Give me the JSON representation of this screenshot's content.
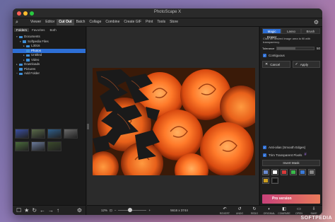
{
  "window": {
    "title": "PhotoScape X"
  },
  "menu": {
    "items": [
      "Viewer",
      "Editor",
      "Cut Out",
      "Batch",
      "Collage",
      "Combine",
      "Create GIF",
      "Print",
      "Tools",
      "Store"
    ],
    "active": "Cut Out"
  },
  "left_panel": {
    "tabs": [
      "Folders",
      "Favorites",
      "Both"
    ],
    "active_tab": "Folders",
    "tree": [
      {
        "label": "Documents",
        "indent": 1,
        "arrow": "▾"
      },
      {
        "label": "Softpedia Files",
        "indent": 2,
        "arrow": "▾"
      },
      {
        "label": "L3016",
        "indent": 3,
        "arrow": "▸"
      },
      {
        "label": "Photos",
        "indent": 3,
        "arrow": "",
        "selected": true
      },
      {
        "label": "Untitled",
        "indent": 3,
        "arrow": "▸"
      },
      {
        "label": "Video",
        "indent": 3,
        "arrow": "▸"
      },
      {
        "label": "Downloads",
        "indent": 1,
        "arrow": "▸"
      },
      {
        "label": "Pictures",
        "indent": 1,
        "arrow": ""
      },
      {
        "label": "Add Folder",
        "indent": 1,
        "arrow": "+"
      }
    ],
    "thumbnail_colors": [
      [
        "#3a4fa0",
        "#5a6a4a",
        "#2e5e8a",
        "#6a6a6a"
      ],
      [
        "#4a6a3a",
        "#6a7a9a",
        "#3a4a2a"
      ]
    ]
  },
  "bottom_bar": {
    "zoom": "12%",
    "dimensions": "5616 x 3744",
    "zoom_level": 0.35,
    "actions": [
      {
        "label": "REVERT",
        "icon": "revert-icon",
        "glyph": "↶"
      },
      {
        "label": "UNDO",
        "icon": "undo-icon",
        "glyph": "↺"
      },
      {
        "label": "REDO",
        "icon": "redo-icon",
        "glyph": "↻"
      },
      {
        "label": "ORIGINAL",
        "icon": "original-icon",
        "glyph": "◐"
      },
      {
        "label": "COMPARE",
        "icon": "compare-icon",
        "glyph": "◧"
      },
      {
        "label": "OPEN",
        "icon": "open-icon",
        "glyph": "▭"
      },
      {
        "label": "SAVE",
        "icon": "save-icon",
        "glyph": "⇩"
      },
      {
        "label": "MENU",
        "icon": "menu-icon",
        "glyph": "≡"
      }
    ]
  },
  "right_panel": {
    "tabs": [
      "Magic Eraser",
      "Lasso",
      "Brush"
    ],
    "active_tab": "Magic Eraser",
    "description": "Click on desired image area to fill with transparency.",
    "tolerance_label": "Tolerance",
    "tolerance_value": "50",
    "tolerance_fraction": 0.5,
    "contiguous_label": "Contiguous",
    "cancel_label": "Cancel",
    "apply_label": "Apply",
    "antialias_label": "Anti-alias (Smooth Edges)",
    "trim_label": "Trim Transparent Pixels",
    "invert_label": "Invert Mask",
    "swatches": [
      "#6a8ad0",
      "#ffffff",
      "#d83a3a",
      "#3ab84a",
      "#3a7ad8",
      "#888888",
      "#cfa020",
      "#111111"
    ],
    "promo_text": "Pro version"
  },
  "watermark": "SOFTPEDIA"
}
